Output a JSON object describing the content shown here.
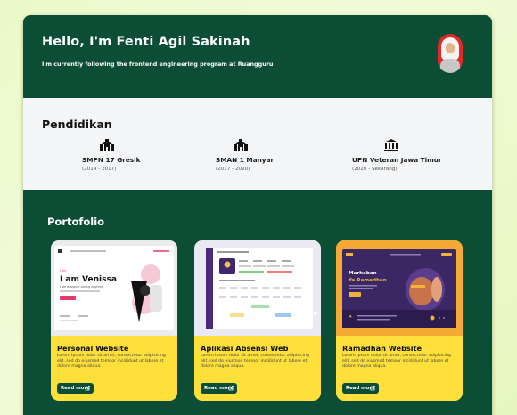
{
  "profile": {
    "greeting": "Hello, I'm Fenti Agil Sakinah",
    "tagline": "I'm currently following the frontend engineering program at Ruangguru"
  },
  "education": {
    "title": "Pendidikan",
    "items": [
      {
        "name": "SMPN 17 Gresik",
        "years": "(2014 - 2017)",
        "icon": "school-icon"
      },
      {
        "name": "SMAN 1 Manyar",
        "years": "(2017 - 2020)",
        "icon": "school-icon"
      },
      {
        "name": "UPN Veteran Jawa Timur",
        "years": "(2020 - Sekarang)",
        "icon": "university-icon"
      }
    ]
  },
  "portfolio": {
    "title": "Portofolio",
    "items": [
      {
        "title": "Personal Website",
        "description": "Lorem ipsum dolor sit amet, consectetur adipisicing elit, sed do eiusmod tempor incididunt ut labore et dolore magna aliqua.",
        "button": "Read more",
        "preview": {
          "headline": "I am Venissa",
          "sub": "I am designer during daytime"
        }
      },
      {
        "title": "Aplikasi Absensi Web",
        "description": "Lorem ipsum dolor sit amet, consectetur adipisicing elit, sed do eiusmod tempor incididunt ut labore et dolore magna aliqua.",
        "button": "Read more",
        "preview": {
          "headline": "",
          "sub": ""
        }
      },
      {
        "title": "Ramadhan Website",
        "description": "Lorem ipsum dolor sit amet, consectetur adipisicing elit, sed do eiusmod tempor incididunt ut labore et dolore magna aliqua.",
        "button": "Read more",
        "preview": {
          "headline": "Marhaban",
          "sub": "Ya Ramadhan"
        }
      }
    ]
  },
  "colors": {
    "primary": "#0c4d36",
    "card": "#ffe03a",
    "section_light": "#f4f5f7",
    "background": "#eaf9c9"
  }
}
